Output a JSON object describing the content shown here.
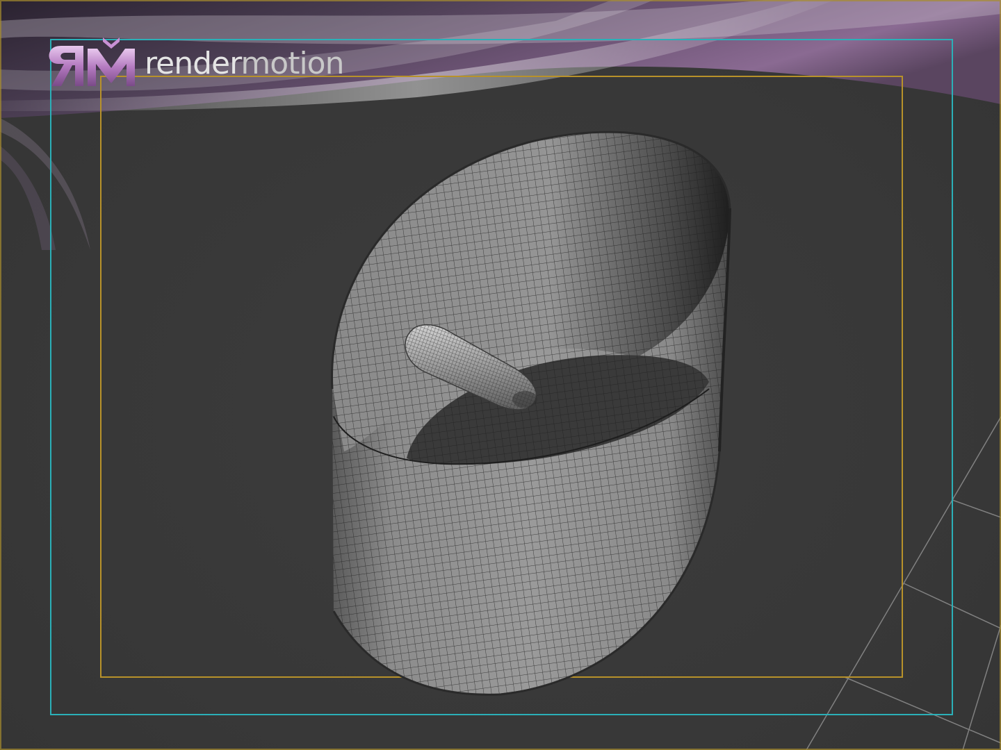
{
  "brand": {
    "mark": "RM",
    "word_part1": "render",
    "word_part2": "motion"
  },
  "colors": {
    "viewport_background": "#3a3a3a",
    "safe_frame_outer": "#2bb0b8",
    "safe_frame_inner": "#b8922a",
    "render_region": "#a88d2e",
    "mesh_wire": "#1e1e1e",
    "mesh_surface": "#8a8a8a",
    "brand_purple": "#9b5aa8",
    "grid_lines": "#9a9a9a"
  },
  "viewport": {
    "shading_mode": "wireframe-on-shaded",
    "objects": [
      "oval-band-mesh",
      "bullet-mesh"
    ],
    "safe_frames": [
      "action-safe",
      "title-safe"
    ]
  }
}
